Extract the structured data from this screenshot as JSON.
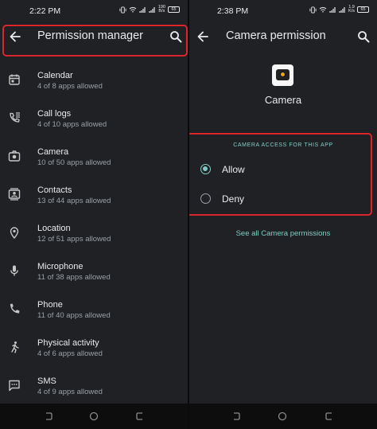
{
  "left": {
    "status": {
      "time": "2:22 PM",
      "speed_value": "190",
      "speed_unit": "B/s",
      "battery": "65"
    },
    "appbar": {
      "title": "Permission manager"
    },
    "items": [
      {
        "title": "Calendar",
        "subtitle": "4 of 8 apps allowed",
        "icon": "calendar-icon"
      },
      {
        "title": "Call logs",
        "subtitle": "4 of 10 apps allowed",
        "icon": "call-log-icon"
      },
      {
        "title": "Camera",
        "subtitle": "10 of 50 apps allowed",
        "icon": "camera-icon"
      },
      {
        "title": "Contacts",
        "subtitle": "13 of 44 apps allowed",
        "icon": "contacts-icon"
      },
      {
        "title": "Location",
        "subtitle": "12 of 51 apps allowed",
        "icon": "location-icon"
      },
      {
        "title": "Microphone",
        "subtitle": "11 of 38 apps allowed",
        "icon": "microphone-icon"
      },
      {
        "title": "Phone",
        "subtitle": "11 of 40 apps allowed",
        "icon": "phone-icon"
      },
      {
        "title": "Physical activity",
        "subtitle": "4 of 6 apps allowed",
        "icon": "physical-activity-icon"
      },
      {
        "title": "SMS",
        "subtitle": "4 of 9 apps allowed",
        "icon": "sms-icon"
      }
    ]
  },
  "right": {
    "status": {
      "time": "2:38 PM",
      "speed_value": "1.9",
      "speed_unit": "K/s",
      "battery": "65"
    },
    "appbar": {
      "title": "Camera permission"
    },
    "app_name": "Camera",
    "section_header": "CAMERA ACCESS FOR THIS APP",
    "options": [
      {
        "label": "Allow",
        "selected": true
      },
      {
        "label": "Deny",
        "selected": false
      }
    ],
    "see_all": "See all Camera permissions"
  },
  "colors": {
    "background": "#202124",
    "accent": "#80cbc4",
    "highlight": "#d9262e",
    "secondary_text": "#9aa0a6"
  }
}
